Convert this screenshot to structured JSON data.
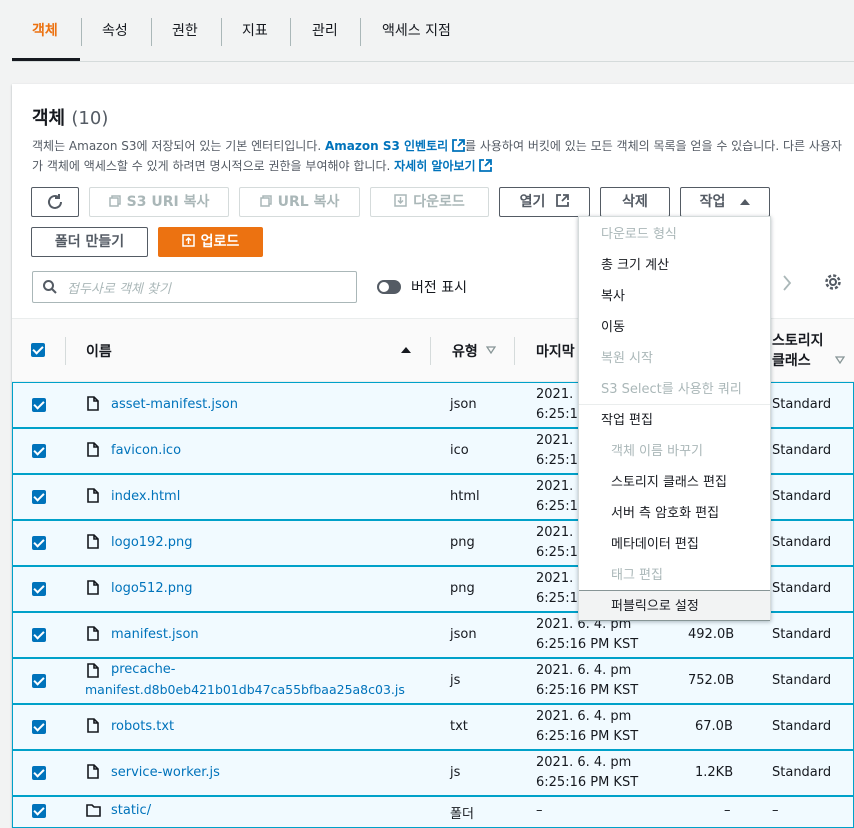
{
  "tabs": [
    {
      "label": "객체"
    },
    {
      "label": "속성"
    },
    {
      "label": "권한"
    },
    {
      "label": "지표"
    },
    {
      "label": "관리"
    },
    {
      "label": "액세스 지점"
    }
  ],
  "panel": {
    "title": "객체",
    "count": "(10)",
    "desc_1": "객체는 Amazon S3에 저장되어 있는 기본 엔터티입니다. ",
    "desc_link1": "Amazon S3 인벤토리",
    "desc_2": "를 사용하여 버킷에 있는 모든 객체의 목록을 얻을 수 있습니다. 다른 사용자가 객체에 액세스할 수 있게 하려면 명시적으로 권한을 부여해야 합니다. ",
    "desc_link2": "자세히 알아보기"
  },
  "toolbar": {
    "copy_s3_uri": "S3 URI 복사",
    "copy_url": "URL 복사",
    "download": "다운로드",
    "open": "열기",
    "delete": "삭제",
    "actions": "작업",
    "create_folder": "폴더 만들기",
    "upload": "업로드"
  },
  "search": {
    "placeholder": "접두사로 객체 찾기"
  },
  "versions": {
    "label": "버전 표시"
  },
  "table": {
    "headers": {
      "name": "이름",
      "type": "유형",
      "modified": "마지막",
      "storage1": "스토리지",
      "storage2": "클래스"
    },
    "rows": [
      {
        "name": "asset-manifest.json",
        "type": "json",
        "date": "2021. 6",
        "time": "6:25:15",
        "size": "",
        "storage": "Standard"
      },
      {
        "name": "favicon.ico",
        "type": "ico",
        "date": "2021. 6",
        "time": "6:25:17",
        "size": "",
        "storage": "Standard"
      },
      {
        "name": "index.html",
        "type": "html",
        "date": "2021. 6",
        "time": "6:25:16",
        "size": "",
        "storage": "Standard"
      },
      {
        "name": "logo192.png",
        "type": "png",
        "date": "2021. 6",
        "time": "6:25:17",
        "size": "",
        "storage": "Standard"
      },
      {
        "name": "logo512.png",
        "type": "png",
        "date": "2021. 6",
        "time": "6:25:17",
        "size": "",
        "storage": "Standard"
      },
      {
        "name": "manifest.json",
        "type": "json",
        "date": "2021. 6. 4. pm",
        "time": "6:25:16 PM KST",
        "size": "492.0B",
        "storage": "Standard"
      },
      {
        "name": "precache-",
        "name2": "manifest.d8b0eb421b01db47ca55bfbaa25a8c03.js",
        "type": "js",
        "date": "2021. 6. 4. pm",
        "time": "6:25:16 PM KST",
        "size": "752.0B",
        "storage": "Standard"
      },
      {
        "name": "robots.txt",
        "type": "txt",
        "date": "2021. 6. 4. pm",
        "time": "6:25:16 PM KST",
        "size": "67.0B",
        "storage": "Standard"
      },
      {
        "name": "service-worker.js",
        "type": "js",
        "date": "2021. 6. 4. pm",
        "time": "6:25:16 PM KST",
        "size": "1.2KB",
        "storage": "Standard"
      },
      {
        "name": "static/",
        "type": "폴더",
        "date": "–",
        "time": "",
        "size": "–",
        "storage": "–"
      }
    ]
  },
  "menu": {
    "items": [
      {
        "label": "다운로드 형식"
      },
      {
        "label": "총 크기 계산"
      },
      {
        "label": "복사"
      },
      {
        "label": "이동"
      },
      {
        "label": "복원 시작"
      },
      {
        "label": "S3 Select를 사용한 쿼리"
      },
      {
        "label": "작업 편집"
      },
      {
        "label": "객체 이름 바꾸기"
      },
      {
        "label": "스토리지 클래스 편집"
      },
      {
        "label": "서버 측 암호화 편집"
      },
      {
        "label": "메타데이터 편집"
      },
      {
        "label": "태그 편집"
      },
      {
        "label": "퍼블릭으로 설정"
      }
    ]
  }
}
